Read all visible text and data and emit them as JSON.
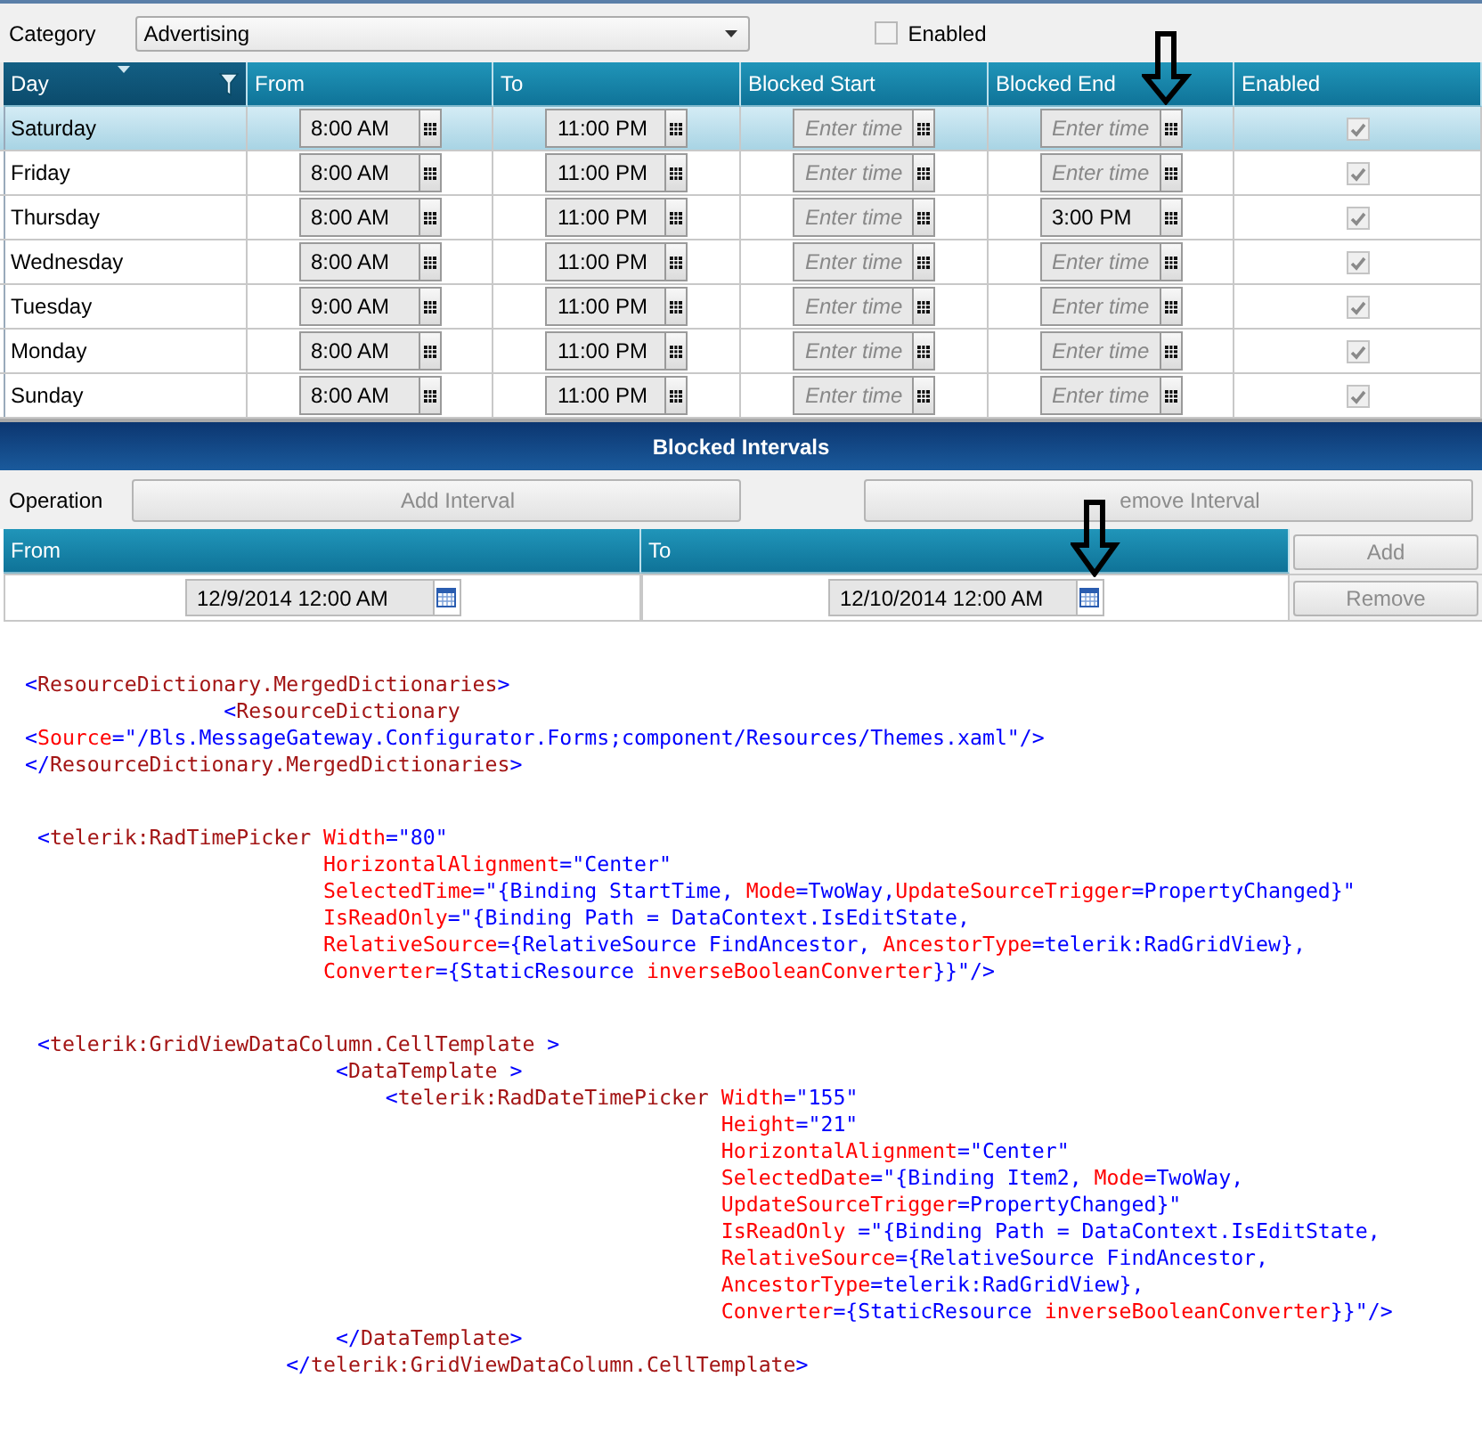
{
  "filter_bar": {
    "category_label": "Category",
    "category_value": "Advertising",
    "enabled_label": "Enabled",
    "enabled_checked": false
  },
  "schedule_grid": {
    "columns": [
      {
        "label": "Day",
        "sorted": true,
        "filter": true
      },
      {
        "label": "From",
        "sorted": false,
        "filter": false
      },
      {
        "label": "To",
        "sorted": false,
        "filter": false
      },
      {
        "label": "Blocked Start",
        "sorted": false,
        "filter": false
      },
      {
        "label": "Blocked End",
        "sorted": false,
        "filter": false
      },
      {
        "label": "Enabled",
        "sorted": false,
        "filter": false
      }
    ],
    "rows": [
      {
        "day": "Saturday",
        "selected": true,
        "from": "8:00 AM",
        "to": "11:00 PM",
        "blocked_start": {
          "placeholder": "Enter time"
        },
        "blocked_end": {
          "placeholder": "Enter time"
        },
        "enabled": true
      },
      {
        "day": "Friday",
        "selected": false,
        "from": "8:00 AM",
        "to": "11:00 PM",
        "blocked_start": {
          "placeholder": "Enter time"
        },
        "blocked_end": {
          "placeholder": "Enter time"
        },
        "enabled": true
      },
      {
        "day": "Thursday",
        "selected": false,
        "from": "8:00 AM",
        "to": "11:00 PM",
        "blocked_start": {
          "placeholder": "Enter time"
        },
        "blocked_end": {
          "value": "3:00 PM"
        },
        "enabled": true
      },
      {
        "day": "Wednesday",
        "selected": false,
        "from": "8:00 AM",
        "to": "11:00 PM",
        "blocked_start": {
          "placeholder": "Enter time"
        },
        "blocked_end": {
          "placeholder": "Enter time"
        },
        "enabled": true
      },
      {
        "day": "Tuesday",
        "selected": false,
        "from": "9:00 AM",
        "to": "11:00 PM",
        "blocked_start": {
          "placeholder": "Enter time"
        },
        "blocked_end": {
          "placeholder": "Enter time"
        },
        "enabled": true
      },
      {
        "day": "Monday",
        "selected": false,
        "from": "8:00 AM",
        "to": "11:00 PM",
        "blocked_start": {
          "placeholder": "Enter time"
        },
        "blocked_end": {
          "placeholder": "Enter time"
        },
        "enabled": true
      },
      {
        "day": "Sunday",
        "selected": false,
        "from": "8:00 AM",
        "to": "11:00 PM",
        "blocked_start": {
          "placeholder": "Enter time"
        },
        "blocked_end": {
          "placeholder": "Enter time"
        },
        "enabled": true
      }
    ]
  },
  "blocked_intervals": {
    "title": "Blocked Intervals",
    "operation_label": "Operation",
    "buttons": [
      {
        "label": "Add Interval",
        "disabled": true
      },
      {
        "label": "emove Interval",
        "disabled": true
      }
    ],
    "grid": {
      "columns": [
        "From",
        "To"
      ],
      "add_button": {
        "label": "Add",
        "disabled": true
      },
      "rows": [
        {
          "from": "12/9/2014 12:00 AM",
          "to": "12/10/2014 12:00 AM",
          "remove_button": {
            "label": "Remove",
            "disabled": true
          }
        }
      ]
    }
  },
  "code_blocks": [
    {
      "lines": [
        [
          {
            "kind": "punct",
            "text": "<"
          },
          {
            "kind": "tag",
            "text": "ResourceDictionary.MergedDictionaries"
          },
          {
            "kind": "punct",
            "text": ">"
          }
        ],
        [
          {
            "kind": "punct",
            "text": "                <"
          },
          {
            "kind": "tag",
            "text": "ResourceDictionary"
          }
        ],
        [
          {
            "kind": "punct",
            "text": "<"
          },
          {
            "kind": "attr",
            "text": "Source"
          },
          {
            "kind": "punct",
            "text": "=\"/Bls.MessageGateway.Configurator.Forms;component/Resources/Themes.xaml\"/>"
          }
        ],
        [
          {
            "kind": "punct",
            "text": "</"
          },
          {
            "kind": "tag",
            "text": "ResourceDictionary.MergedDictionaries"
          },
          {
            "kind": "punct",
            "text": ">"
          }
        ]
      ]
    },
    {
      "lines": [
        [
          {
            "kind": "punct",
            "text": " <"
          },
          {
            "kind": "tag",
            "text": "telerik:RadTimePicker"
          },
          {
            "kind": "attr",
            "text": " Width"
          },
          {
            "kind": "punct",
            "text": "=\"80\""
          }
        ],
        [
          {
            "kind": "attr",
            "text": "                        HorizontalAlignment"
          },
          {
            "kind": "punct",
            "text": "=\"Center\""
          }
        ],
        [
          {
            "kind": "attr",
            "text": "                        SelectedTime"
          },
          {
            "kind": "punct",
            "text": "=\"{Binding StartTime, "
          },
          {
            "kind": "attr",
            "text": "Mode"
          },
          {
            "kind": "punct",
            "text": "=TwoWay,"
          },
          {
            "kind": "attr",
            "text": "UpdateSourceTrigger"
          },
          {
            "kind": "punct",
            "text": "=PropertyChanged}\""
          }
        ],
        [
          {
            "kind": "attr",
            "text": "                        IsReadOnly"
          },
          {
            "kind": "punct",
            "text": "=\"{Binding Path = DataContext.IsEditState,"
          }
        ],
        [
          {
            "kind": "attr",
            "text": "                        RelativeSource"
          },
          {
            "kind": "punct",
            "text": "={RelativeSource FindAncestor, "
          },
          {
            "kind": "attr",
            "text": "AncestorType"
          },
          {
            "kind": "punct",
            "text": "=telerik:RadGridView},"
          }
        ],
        [
          {
            "kind": "attr",
            "text": "                        Converter"
          },
          {
            "kind": "punct",
            "text": "={StaticResource "
          },
          {
            "kind": "attr",
            "text": "inverseBooleanConverter"
          },
          {
            "kind": "punct",
            "text": "}}\"/>"
          }
        ]
      ]
    },
    {
      "lines": [
        [
          {
            "kind": "punct",
            "text": " <"
          },
          {
            "kind": "tag",
            "text": "telerik:GridViewDataColumn.CellTemplate"
          },
          {
            "kind": "punct",
            "text": " >"
          }
        ],
        [
          {
            "kind": "punct",
            "text": "                         <"
          },
          {
            "kind": "tag",
            "text": "DataTemplate"
          },
          {
            "kind": "punct",
            "text": " >"
          }
        ],
        [
          {
            "kind": "punct",
            "text": "                             <"
          },
          {
            "kind": "tag",
            "text": "telerik:RadDateTimePicker"
          },
          {
            "kind": "attr",
            "text": " Width"
          },
          {
            "kind": "punct",
            "text": "=\"155\""
          }
        ],
        [
          {
            "kind": "attr",
            "text": "                                                        Height"
          },
          {
            "kind": "punct",
            "text": "=\"21\""
          }
        ],
        [
          {
            "kind": "attr",
            "text": "                                                        HorizontalAlignment"
          },
          {
            "kind": "punct",
            "text": "=\"Center\""
          }
        ],
        [
          {
            "kind": "attr",
            "text": "                                                        SelectedDate"
          },
          {
            "kind": "punct",
            "text": "=\"{Binding Item2, "
          },
          {
            "kind": "attr",
            "text": "Mode"
          },
          {
            "kind": "punct",
            "text": "=TwoWay,"
          }
        ],
        [
          {
            "kind": "attr",
            "text": "                                                        UpdateSourceTrigger"
          },
          {
            "kind": "punct",
            "text": "=PropertyChanged}\""
          }
        ],
        [
          {
            "kind": "attr",
            "text": "                                                        IsReadOnly"
          },
          {
            "kind": "punct",
            "text": " =\"{Binding Path = DataContext.IsEditState,"
          }
        ],
        [
          {
            "kind": "attr",
            "text": "                                                        RelativeSource"
          },
          {
            "kind": "punct",
            "text": "={RelativeSource FindAncestor,"
          }
        ],
        [
          {
            "kind": "attr",
            "text": "                                                        AncestorType"
          },
          {
            "kind": "punct",
            "text": "=telerik:RadGridView},"
          }
        ],
        [
          {
            "kind": "attr",
            "text": "                                                        Converter"
          },
          {
            "kind": "punct",
            "text": "={StaticResource "
          },
          {
            "kind": "attr",
            "text": "inverseBooleanConverter"
          },
          {
            "kind": "punct",
            "text": "}}\"/>"
          }
        ],
        [
          {
            "kind": "punct",
            "text": "                         </"
          },
          {
            "kind": "tag",
            "text": "DataTemplate"
          },
          {
            "kind": "punct",
            "text": ">"
          }
        ],
        [
          {
            "kind": "punct",
            "text": "                     </"
          },
          {
            "kind": "tag",
            "text": "telerik:GridViewDataColumn.CellTemplate"
          },
          {
            "kind": "punct",
            "text": ">"
          }
        ]
      ]
    }
  ]
}
